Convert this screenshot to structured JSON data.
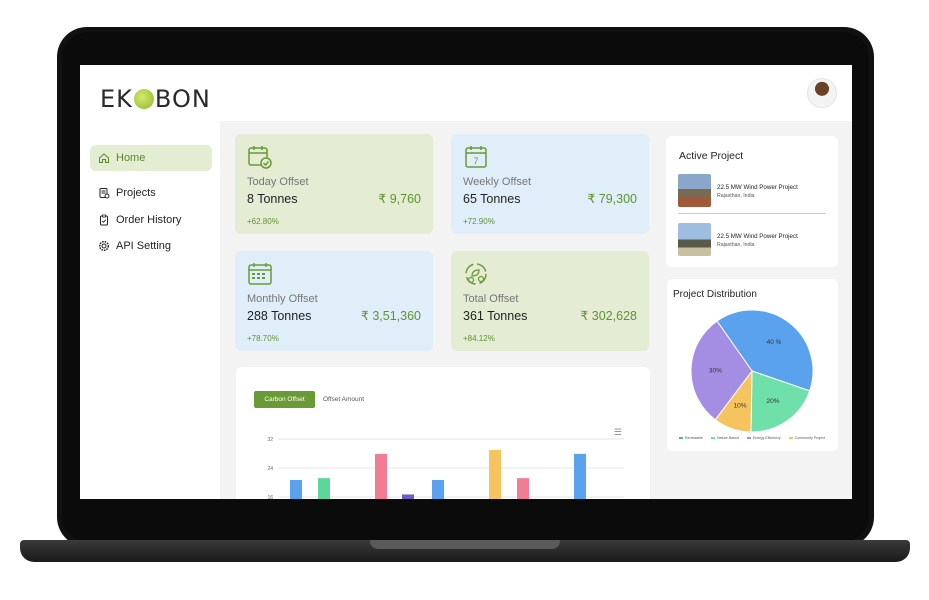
{
  "app": {
    "logo_text": "EKOBON",
    "accent": "#6a9a35"
  },
  "sidebar": {
    "items": [
      {
        "label": "Home",
        "icon": "home-icon"
      },
      {
        "label": "Projects",
        "icon": "projects-icon"
      },
      {
        "label": "Order History",
        "icon": "order-history-icon"
      },
      {
        "label": "API Setting",
        "icon": "api-setting-icon"
      }
    ]
  },
  "stats": [
    {
      "label": "Today Offset",
      "amount": "8 Tonnes",
      "value": "₹ 9,760",
      "change": "+62.80%",
      "icon": "calendar-check-icon",
      "color": "#e4ecd4"
    },
    {
      "label": "Weekly Offset",
      "amount": "65 Tonnes",
      "value": "₹ 79,300",
      "change": "+72.90%",
      "icon": "calendar-week-icon",
      "color": "#dfeef8"
    },
    {
      "label": "Monthly Offset",
      "amount": "288 Tonnes",
      "value": "₹ 3,51,360",
      "change": "+78.70%",
      "icon": "calendar-month-icon",
      "color": "#dfeef8"
    },
    {
      "label": "Total Offset",
      "amount": "361 Tonnes",
      "value": "₹ 302,628",
      "change": "+84.12%",
      "icon": "eco-cycle-icon",
      "color": "#e4ecd4"
    }
  ],
  "chart_tabs": {
    "carbon": "Carbon Offset",
    "offset": "Offset Amount",
    "menu_icon": "hamburger-menu-icon"
  },
  "chart_data": {
    "type": "bar",
    "y_ticks": [
      "32",
      "24",
      "16"
    ],
    "ylim": [
      16,
      32
    ],
    "bars": [
      {
        "value": 20.7,
        "color": "#5aa2ee"
      },
      {
        "value": 21.2,
        "color": "#5cd69a"
      },
      {
        "value": 27.9,
        "color": "#f07d93"
      },
      {
        "value": 16.7,
        "color": "#6b5ec9"
      },
      {
        "value": 20.7,
        "color": "#5aa2ee"
      },
      {
        "value": 29.0,
        "color": "#f5c45e"
      },
      {
        "value": 21.2,
        "color": "#f07d93"
      },
      {
        "value": 27.9,
        "color": "#5aa2ee"
      }
    ]
  },
  "active_projects": {
    "title": "Active Project",
    "items": [
      {
        "name": "22.5 MW Wind Power Project",
        "location": "Rajasthan, India"
      },
      {
        "name": "22.5 MW Wind Power Project",
        "location": "Rajasthan, India"
      }
    ]
  },
  "distribution": {
    "title": "Project Distribution",
    "slices": [
      {
        "label": "40 %",
        "value": 40,
        "color": "#5aa2ee"
      },
      {
        "label": "20%",
        "value": 20,
        "color": "#6fe0aa"
      },
      {
        "label": "10%",
        "value": 10,
        "color": "#f5c45e"
      },
      {
        "label": "30%",
        "value": 30,
        "color": "#a48ee3"
      }
    ],
    "legend": [
      {
        "label": "Renewable",
        "color": "#5aa2ee"
      },
      {
        "label": "Nature Based",
        "color": "#6fe0aa"
      },
      {
        "label": "Energy Efficiency",
        "color": "#a48ee3"
      },
      {
        "label": "Community Project",
        "color": "#f5c45e"
      }
    ]
  }
}
